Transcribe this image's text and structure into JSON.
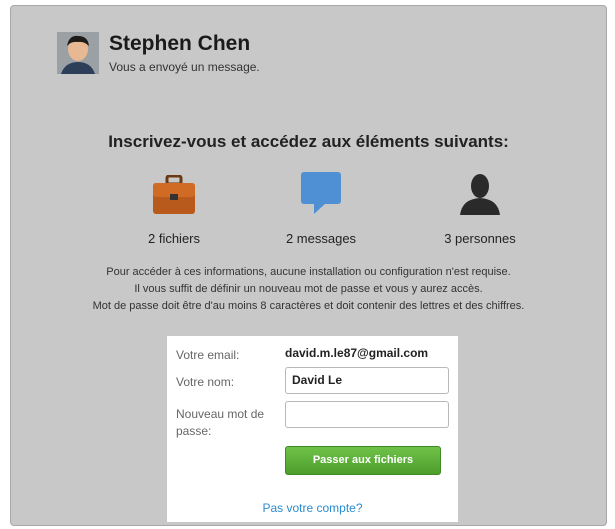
{
  "sender": {
    "name": "Stephen Chen",
    "subtitle": "Vous a envoyé un message."
  },
  "heading": "Inscrivez-vous et accédez aux éléments suivants:",
  "features": [
    {
      "icon": "briefcase-icon",
      "label": "2 fichiers"
    },
    {
      "icon": "chat-bubble-icon",
      "label": "2 messages"
    },
    {
      "icon": "person-icon",
      "label": "3 personnes"
    }
  ],
  "info_lines": [
    "Pour accéder à ces informations, aucune installation ou configuration n'est requise.",
    "Il vous suffit de définir un nouveau mot de passe et vous y aurez accès.",
    "Mot de passe doit être d'au moins 8 caractères et doit contenir des lettres et des chiffres."
  ],
  "form": {
    "email_label": "Votre email:",
    "email_value": "david.m.le87@gmail.com",
    "name_label": "Votre nom:",
    "name_value": "David Le",
    "password_label": "Nouveau mot de passe:",
    "password_value": "",
    "submit_label": "Passer aux fichiers",
    "not_account_link": "Pas votre compte?"
  },
  "colors": {
    "accent_green": "#55a832",
    "link_blue": "#2a8ccf",
    "panel_gray": "#c8c8c8"
  }
}
